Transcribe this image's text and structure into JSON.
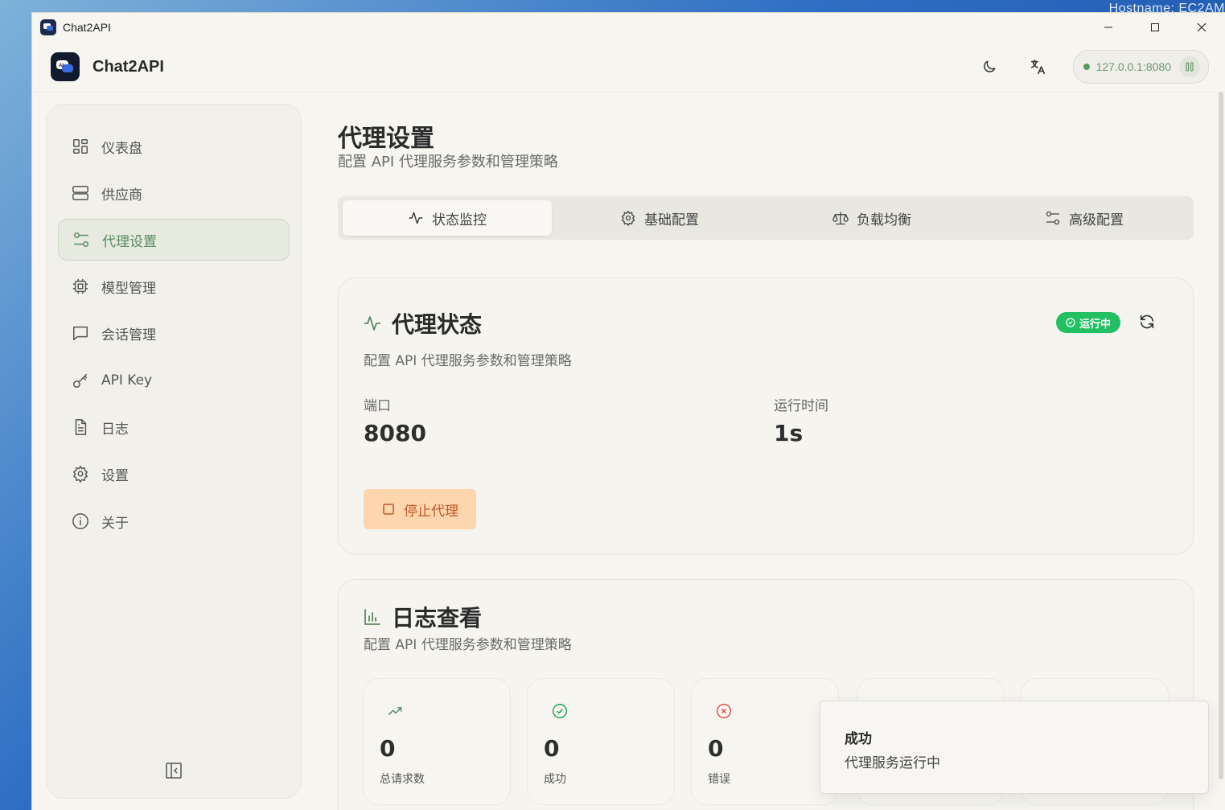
{
  "desktop": {
    "label": "Hostname: EC2AM"
  },
  "window": {
    "title": "Chat2API"
  },
  "header": {
    "brand": "Chat2API",
    "server_address": "127.0.0.1:8080"
  },
  "sidebar": {
    "items": [
      {
        "label": "仪表盘",
        "icon": "dashboard-icon"
      },
      {
        "label": "供应商",
        "icon": "server-icon"
      },
      {
        "label": "代理设置",
        "icon": "sliders-icon",
        "active": true
      },
      {
        "label": "模型管理",
        "icon": "cpu-icon"
      },
      {
        "label": "会话管理",
        "icon": "message-icon"
      },
      {
        "label": "API Key",
        "icon": "key-icon"
      },
      {
        "label": "日志",
        "icon": "file-icon"
      },
      {
        "label": "设置",
        "icon": "gear-icon"
      },
      {
        "label": "关于",
        "icon": "info-icon"
      }
    ]
  },
  "page": {
    "title": "代理设置",
    "subtitle": "配置 API 代理服务参数和管理策略"
  },
  "tabs": [
    {
      "label": "状态监控",
      "active": true
    },
    {
      "label": "基础配置"
    },
    {
      "label": "负载均衡"
    },
    {
      "label": "高级配置"
    }
  ],
  "proxy_status": {
    "title": "代理状态",
    "subtitle": "配置 API 代理服务参数和管理策略",
    "badge": "运行中",
    "port_label": "端口",
    "port_value": "8080",
    "uptime_label": "运行时间",
    "uptime_value": "1s",
    "stop_button": "停止代理"
  },
  "logs": {
    "title": "日志查看",
    "subtitle": "配置 API 代理服务参数和管理策略",
    "stats": [
      {
        "value": "0",
        "label": "总请求数"
      },
      {
        "value": "0",
        "label": "成功"
      },
      {
        "value": "0",
        "label": "错误"
      },
      {
        "value": "",
        "label": ""
      },
      {
        "value": "",
        "label": ""
      }
    ]
  },
  "toast": {
    "title": "成功",
    "message": "代理服务运行中"
  },
  "colors": {
    "accent": "#5b8a62",
    "running": "#22c063",
    "stop_bg": "#fdd6ae",
    "stop_text": "#c2552a"
  }
}
